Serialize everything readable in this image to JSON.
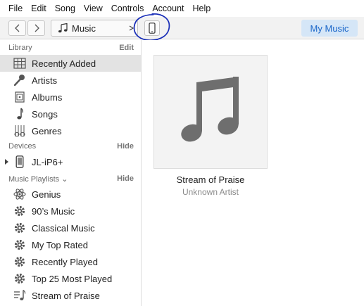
{
  "menu": [
    "File",
    "Edit",
    "Song",
    "View",
    "Controls",
    "Account",
    "Help"
  ],
  "toolbar": {
    "media_kind": "Music",
    "my_music_label": "My Music"
  },
  "sidebar": {
    "library": {
      "title": "Library",
      "action": "Edit",
      "items": [
        {
          "label": "Recently Added",
          "icon": "grid-icon"
        },
        {
          "label": "Artists",
          "icon": "microphone-icon"
        },
        {
          "label": "Albums",
          "icon": "album-icon"
        },
        {
          "label": "Songs",
          "icon": "music-note-icon"
        },
        {
          "label": "Genres",
          "icon": "guitar-icon"
        }
      ]
    },
    "devices": {
      "title": "Devices",
      "action": "Hide",
      "items": [
        {
          "label": "JL-iP6+",
          "icon": "iphone-icon"
        }
      ]
    },
    "playlists": {
      "title": "Music Playlists",
      "action": "Hide",
      "items": [
        {
          "label": "Genius",
          "icon": "genius-atom-icon"
        },
        {
          "label": "90’s Music",
          "icon": "smart-playlist-gear-icon"
        },
        {
          "label": "Classical Music",
          "icon": "smart-playlist-gear-icon"
        },
        {
          "label": "My Top Rated",
          "icon": "smart-playlist-gear-icon"
        },
        {
          "label": "Recently Played",
          "icon": "smart-playlist-gear-icon"
        },
        {
          "label": "Top 25 Most Played",
          "icon": "smart-playlist-gear-icon"
        },
        {
          "label": "Stream of Praise",
          "icon": "playlist-icon"
        }
      ]
    }
  },
  "content": {
    "album": {
      "title": "Stream of Praise",
      "artist": "Unknown Artist"
    }
  },
  "colors": {
    "accent": "#1a66c9",
    "accent_bg": "#d5e6f7",
    "annotation": "#1a2fb8",
    "selected_row": "#e3e3e3"
  }
}
